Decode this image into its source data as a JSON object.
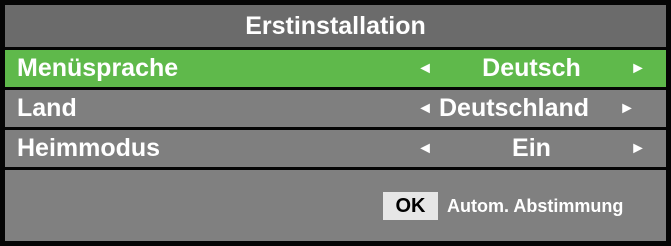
{
  "title": "Erstinstallation",
  "menu": [
    {
      "label": "Menüsprache",
      "value": "Deutsch",
      "selected": true
    },
    {
      "label": "Land",
      "value": "Deutschland",
      "selected": false
    },
    {
      "label": "Heimmodus",
      "value": "Ein",
      "selected": false
    }
  ],
  "arrows": {
    "left": "◄",
    "right": "►"
  },
  "footer": {
    "ok_key": "OK",
    "ok_action": "Autom. Abstimmung"
  },
  "colors": {
    "frame": "#050505",
    "panel": "#808080",
    "title_bar": "#6b6b6b",
    "selected_row": "#5fb94b",
    "ok_badge": "#e6e6e6"
  }
}
